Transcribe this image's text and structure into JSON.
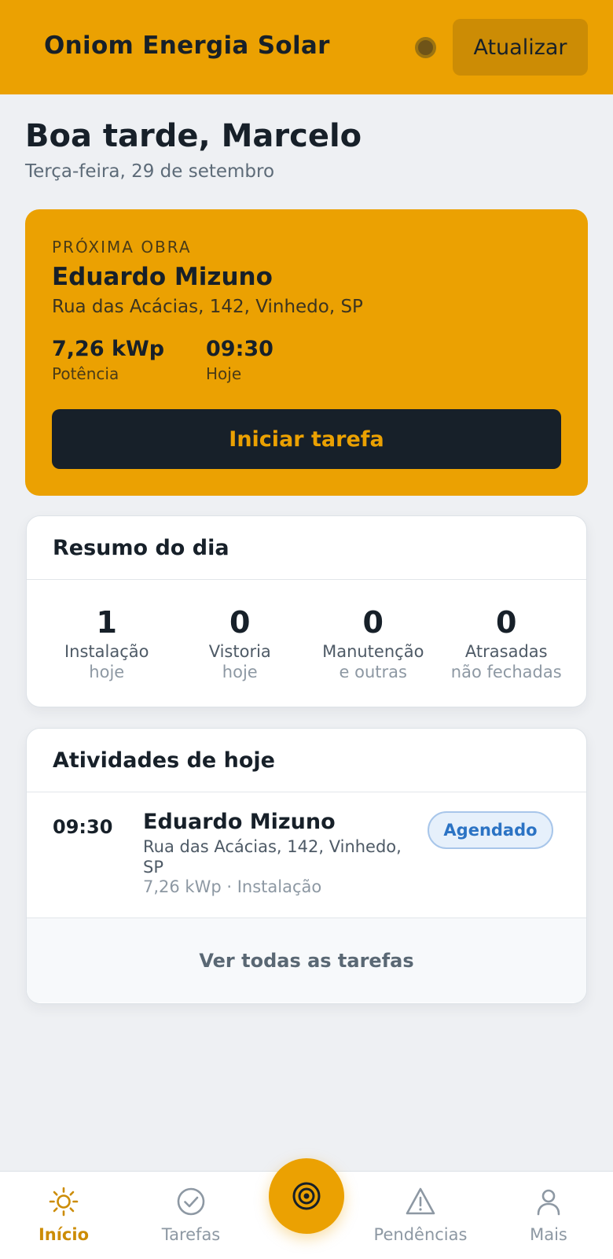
{
  "header": {
    "app_title": "Oniom Energia Solar",
    "refresh_label": "Atualizar"
  },
  "greeting": {
    "title": "Boa tarde, Marcelo",
    "date": "Terça-feira, 29 de setembro"
  },
  "next_job": {
    "label": "PRÓXIMA OBRA",
    "client": "Eduardo Mizuno",
    "address": "Rua das Acácias, 142, Vinhedo, SP",
    "power_value": "7,26 kWp",
    "power_label": "Potência",
    "time_value": "09:30",
    "time_label": "Hoje",
    "start_label": "Iniciar tarefa"
  },
  "summary": {
    "title": "Resumo do dia",
    "items": [
      {
        "count": "1",
        "label": "Instalação",
        "sub": "hoje"
      },
      {
        "count": "0",
        "label": "Vistoria",
        "sub": "hoje"
      },
      {
        "count": "0",
        "label": "Manutenção",
        "sub": "e outras"
      },
      {
        "count": "0",
        "label": "Atrasadas",
        "sub": "não fechadas"
      }
    ]
  },
  "activities": {
    "title": "Atividades de hoje",
    "items": [
      {
        "time": "09:30",
        "client": "Eduardo Mizuno",
        "address": "Rua das Acácias, 142, Vinhedo, SP",
        "meta": "7,26 kWp · Instalação",
        "status": "Agendado"
      }
    ],
    "see_all_label": "Ver todas as tarefas"
  },
  "nav": {
    "items": [
      {
        "label": "Início",
        "icon": "sun-icon",
        "active": true
      },
      {
        "label": "Tarefas",
        "icon": "check-circle-icon",
        "active": false
      },
      {
        "label": "Pendências",
        "icon": "warning-icon",
        "active": false
      },
      {
        "label": "Mais",
        "icon": "user-icon",
        "active": false
      }
    ],
    "fab_icon": "target-icon"
  },
  "colors": {
    "accent": "#eba102",
    "dark": "#172029",
    "background": "#eef0f3",
    "badge_blue": "#2b73c4"
  }
}
